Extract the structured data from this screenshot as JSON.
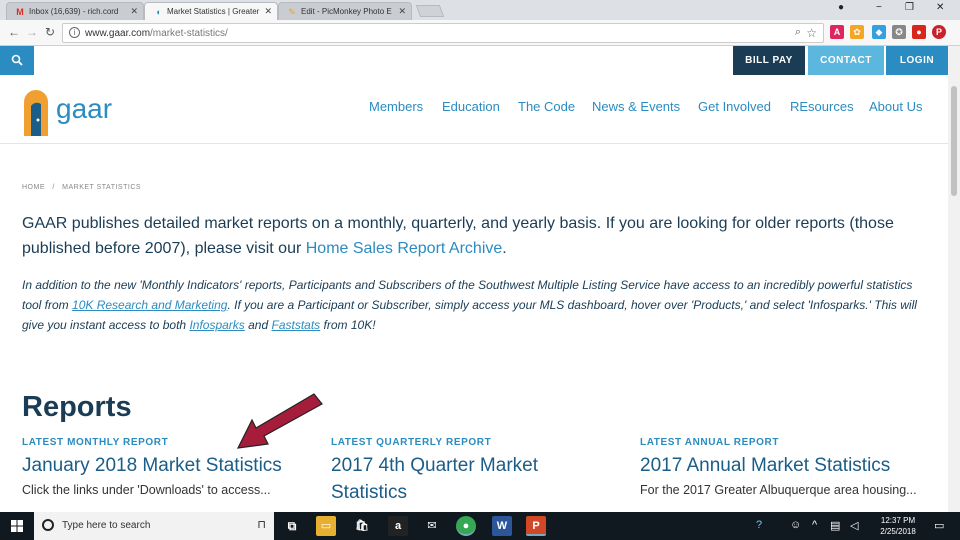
{
  "browser": {
    "tabs": [
      {
        "title": "Inbox (16,639) - rich.cord",
        "icon": "gmail-icon",
        "color": "#d93025"
      },
      {
        "title": "Market Statistics | Greater",
        "icon": "gaar-icon",
        "color": "#2a8cc0"
      },
      {
        "title": "Edit - PicMonkey Photo E",
        "icon": "picmonkey-icon",
        "color": "#f0a030"
      }
    ],
    "url_host": "www.gaar.com",
    "url_path": "/market-statistics/",
    "window_controls": [
      "−",
      "❐",
      "✕"
    ]
  },
  "site": {
    "top_buttons": [
      {
        "label": "BILL PAY",
        "bg": "#1a3d55"
      },
      {
        "label": "CONTACT",
        "bg": "#5bb7de"
      },
      {
        "label": "LOGIN",
        "bg": "#2a8cc0"
      }
    ],
    "logo_text": "gaar",
    "nav": [
      "Members",
      "Education",
      "The Code",
      "News & Events",
      "Get Involved",
      "REsources",
      "About Us"
    ]
  },
  "page": {
    "breadcrumb": [
      "HOME",
      "/",
      "MARKET STATISTICS"
    ],
    "lead_text": "GAAR publishes detailed market reports on a monthly, quarterly, and yearly basis. If you are looking for older reports (those published before 2007), please visit our ",
    "lead_link": "Home Sales Report Archive",
    "lead_end": ".",
    "intro_1": "In addition to the new 'Monthly Indicators' reports, Participants and Subscribers of the Southwest Multiple Listing Service have access to an incredibly powerful statistics tool from ",
    "intro_link_1": "10K Research and Marketing",
    "intro_2": ". If you are a Participant or Subscriber, simply access your MLS dashboard, hover over 'Products,' and select 'Infosparks.' This will give you instant access to both ",
    "intro_link_2": "Infosparks",
    "intro_3": " and ",
    "intro_link_3": "Faststats",
    "intro_4": " from 10K!",
    "reports_heading": "Reports",
    "reports": [
      {
        "label": "LATEST MONTHLY REPORT",
        "title": "January 2018 Market Statistics",
        "desc": "Click the links under 'Downloads' to access..."
      },
      {
        "label": "LATEST QUARTERLY REPORT",
        "title": "2017 4th Quarter Market Statistics",
        "desc": ""
      },
      {
        "label": "LATEST ANNUAL REPORT",
        "title": "2017 Annual Market Statistics",
        "desc": "For the 2017 Greater Albuquerque area housing..."
      }
    ]
  },
  "taskbar": {
    "search_placeholder": "Type here to search",
    "time": "12:37 PM",
    "date": "2/25/2018"
  }
}
